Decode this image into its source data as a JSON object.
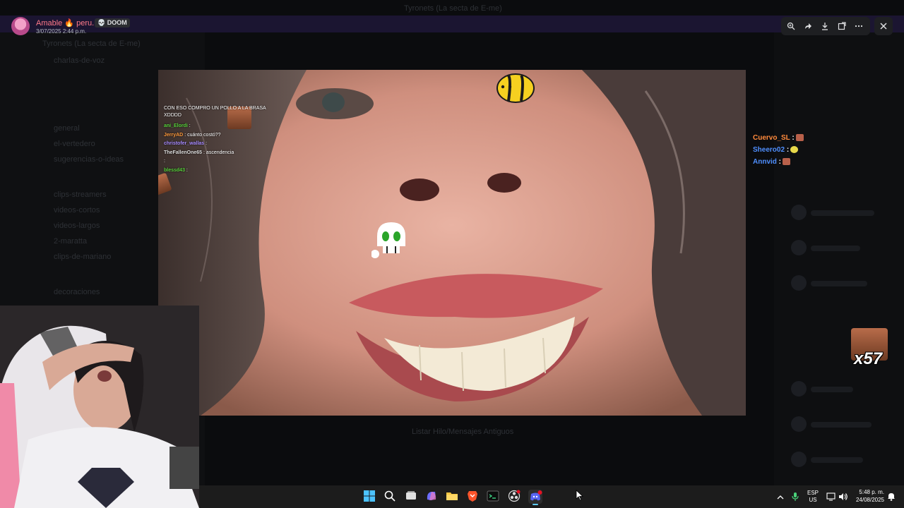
{
  "window": {
    "title": "Tyronets (La secta de E-me)"
  },
  "viewer": {
    "user_name": "Amable 🔥 peru...",
    "user_tag": "💀 DOOM",
    "date": "3/07/2025 2:44 p.m.",
    "toolbar_icons": [
      "zoom-icon",
      "forward-icon",
      "download-icon",
      "open-external-icon",
      "more-icon"
    ],
    "close_icon": "close-icon"
  },
  "background": {
    "server_name": "Tyronets (La secta de E-me)",
    "channels": [
      "charlas-de-voz",
      "general",
      "el-vertedero",
      "sugerencias-o-ideas",
      "clips-streamers",
      "videos-cortos",
      "videos-largos",
      "2-maratta",
      "clips-de-mariano",
      "decoraciones"
    ],
    "status_text": "Listar Hilo/Mensajes Antiguos"
  },
  "twitch_chat": [
    {
      "user": "",
      "text": "CON ESO COMPRO UN POLLO A LA BRASA XDDDD",
      "color": "#7cc7ff"
    },
    {
      "user": "ani_Elordi",
      "text": ":",
      "color": "#57d13b"
    },
    {
      "user": "JerryAD",
      "text": ": cuánto costó??",
      "color": "#ff9a3c"
    },
    {
      "user": "christofer_wallas",
      "text": ":",
      "color": "#a78bff"
    },
    {
      "user": "TheFallenOne65",
      "text": ": ascendencia",
      "color": "#dddddd"
    },
    {
      "user": "",
      "text": ":",
      "color": "#a78bff"
    },
    {
      "user": "blessd43",
      "text": ":",
      "color": "#57d13b"
    }
  ],
  "right_chat": [
    {
      "user": "Cuervo_SL",
      "text": ":",
      "color": "#ff8a3c",
      "emote_color": "#b8604a"
    },
    {
      "user": "Sheero02",
      "text": ":",
      "color": "#4f8fff",
      "emote_color": "#e7d84a"
    },
    {
      "user": "Annvid",
      "text": ":",
      "color": "#4f8fff",
      "emote_color": "#b8604a"
    }
  ],
  "combo_counter": "x57",
  "taskbar": {
    "icons": [
      "windows-start-icon",
      "search-icon",
      "task-view-icon",
      "copilot-icon",
      "file-explorer-icon",
      "brave-icon",
      "terminal-icon",
      "obs-icon",
      "discord-icon"
    ],
    "lang_primary": "ESP",
    "lang_secondary": "US",
    "time": "5:48 p. m.",
    "date": "24/08/2025"
  },
  "colors": {
    "accent": "#5865f2",
    "discord_bg": "#0b0c0e",
    "taskbar": "#1c1c1c"
  }
}
